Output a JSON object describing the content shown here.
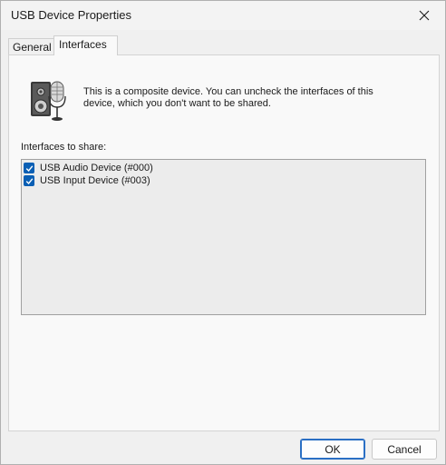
{
  "window": {
    "title": "USB Device Properties",
    "close_icon": "close-icon"
  },
  "tabs": [
    {
      "label": "General"
    },
    {
      "label": "Interfaces"
    }
  ],
  "panel": {
    "device_icon": "speaker-microphone-icon",
    "description": "This is a composite device. You can uncheck the interfaces of this device, which you don't want to be shared.",
    "list_label": "Interfaces to share:",
    "items": [
      {
        "label": "USB Audio Device (#000)",
        "checked": true
      },
      {
        "label": "USB Input Device (#003)",
        "checked": true
      }
    ]
  },
  "buttons": {
    "ok": "OK",
    "cancel": "Cancel"
  },
  "colors": {
    "accent": "#0a5fb4",
    "background": "#f0f0f0",
    "panel": "#f9f9f9",
    "listbox": "#ececec"
  }
}
